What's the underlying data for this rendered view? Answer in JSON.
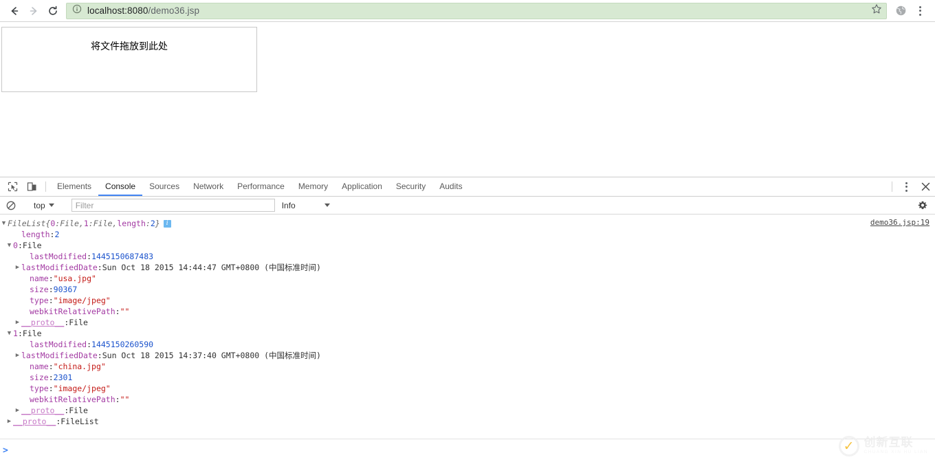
{
  "browser": {
    "back_label": "back-arrow",
    "forward_label": "forward-arrow",
    "reload_label": "reload",
    "url_host": "localhost:8080",
    "url_path": "/demo36.jsp",
    "url_full": "localhost:8080/demo36.jsp",
    "security_icon": "info-circle-icon",
    "bookmark_icon": "star-icon",
    "profile_icon": "globe-icon",
    "menu_icon": "three-dots-vertical-icon"
  },
  "page": {
    "dropzone_text": "将文件拖放到此处"
  },
  "devtools": {
    "inspect_icon": "inspect-element-icon",
    "device_icon": "device-toolbar-icon",
    "tabs": [
      {
        "label": "Elements",
        "active": false
      },
      {
        "label": "Console",
        "active": true
      },
      {
        "label": "Sources",
        "active": false
      },
      {
        "label": "Network",
        "active": false
      },
      {
        "label": "Performance",
        "active": false
      },
      {
        "label": "Memory",
        "active": false
      },
      {
        "label": "Application",
        "active": false
      },
      {
        "label": "Security",
        "active": false
      },
      {
        "label": "Audits",
        "active": false
      }
    ],
    "more_icon": "three-dots-vertical-icon",
    "close_icon": "close-icon",
    "filterbar": {
      "clear_icon": "clear-console-icon",
      "context": "top",
      "filter_placeholder": "Filter",
      "filter_value": "",
      "level": "Info",
      "settings_icon": "gear-icon"
    },
    "console": {
      "source_link": "demo36.jsp:19",
      "prompt_caret": ">",
      "rows": [
        {
          "indent": 0,
          "tri": "▼",
          "parts": [
            {
              "t": "FileList ",
              "c": "cls-italic"
            },
            {
              "t": "{",
              "c": "brace"
            },
            {
              "t": "0",
              "c": "k-prop"
            },
            {
              "t": ": ",
              "c": "brace"
            },
            {
              "t": "File",
              "c": "cls-italic"
            },
            {
              "t": ", ",
              "c": "brace"
            },
            {
              "t": "1",
              "c": "k-prop"
            },
            {
              "t": ": ",
              "c": "brace"
            },
            {
              "t": "File",
              "c": "cls-italic"
            },
            {
              "t": ", ",
              "c": "brace"
            },
            {
              "t": "length",
              "c": "k-prop"
            },
            {
              "t": ": ",
              "c": "brace"
            },
            {
              "t": "2",
              "c": "v-num"
            },
            {
              "t": "}",
              "c": "brace"
            }
          ],
          "badge": "i"
        },
        {
          "indent": 2,
          "tri": "",
          "parts": [
            {
              "t": "length",
              "c": "k-prop"
            },
            {
              "t": ": ",
              "c": "v-plain"
            },
            {
              "t": "2",
              "c": "v-num"
            }
          ]
        },
        {
          "indent": 1,
          "tri": "▼",
          "parts": [
            {
              "t": "0",
              "c": "k-prop"
            },
            {
              "t": ": ",
              "c": "v-plain"
            },
            {
              "t": "File",
              "c": "v-obj"
            }
          ]
        },
        {
          "indent": 3,
          "tri": "",
          "parts": [
            {
              "t": "lastModified",
              "c": "k-prop"
            },
            {
              "t": ": ",
              "c": "v-plain"
            },
            {
              "t": "1445150687483",
              "c": "v-num"
            }
          ]
        },
        {
          "indent": 2,
          "tri": "▶",
          "parts": [
            {
              "t": "lastModifiedDate",
              "c": "k-prop"
            },
            {
              "t": ": ",
              "c": "v-plain"
            },
            {
              "t": "Sun Oct 18 2015 14:44:47 GMT+0800 (中国标准时间)",
              "c": "v-plain"
            }
          ]
        },
        {
          "indent": 3,
          "tri": "",
          "parts": [
            {
              "t": "name",
              "c": "k-prop"
            },
            {
              "t": ": ",
              "c": "v-plain"
            },
            {
              "t": "\"usa.jpg\"",
              "c": "v-str"
            }
          ]
        },
        {
          "indent": 3,
          "tri": "",
          "parts": [
            {
              "t": "size",
              "c": "k-prop"
            },
            {
              "t": ": ",
              "c": "v-plain"
            },
            {
              "t": "90367",
              "c": "v-num"
            }
          ]
        },
        {
          "indent": 3,
          "tri": "",
          "parts": [
            {
              "t": "type",
              "c": "k-prop"
            },
            {
              "t": ": ",
              "c": "v-plain"
            },
            {
              "t": "\"image/jpeg\"",
              "c": "v-str"
            }
          ]
        },
        {
          "indent": 3,
          "tri": "",
          "parts": [
            {
              "t": "webkitRelativePath",
              "c": "k-prop"
            },
            {
              "t": ": ",
              "c": "v-plain"
            },
            {
              "t": "\"\"",
              "c": "v-str"
            }
          ]
        },
        {
          "indent": 2,
          "tri": "▶",
          "parts": [
            {
              "t": "__proto__",
              "c": "k-proto"
            },
            {
              "t": ": ",
              "c": "v-plain"
            },
            {
              "t": "File",
              "c": "v-obj"
            }
          ]
        },
        {
          "indent": 1,
          "tri": "▼",
          "parts": [
            {
              "t": "1",
              "c": "k-prop"
            },
            {
              "t": ": ",
              "c": "v-plain"
            },
            {
              "t": "File",
              "c": "v-obj"
            }
          ]
        },
        {
          "indent": 3,
          "tri": "",
          "parts": [
            {
              "t": "lastModified",
              "c": "k-prop"
            },
            {
              "t": ": ",
              "c": "v-plain"
            },
            {
              "t": "1445150260590",
              "c": "v-num"
            }
          ]
        },
        {
          "indent": 2,
          "tri": "▶",
          "parts": [
            {
              "t": "lastModifiedDate",
              "c": "k-prop"
            },
            {
              "t": ": ",
              "c": "v-plain"
            },
            {
              "t": "Sun Oct 18 2015 14:37:40 GMT+0800 (中国标准时间)",
              "c": "v-plain"
            }
          ]
        },
        {
          "indent": 3,
          "tri": "",
          "parts": [
            {
              "t": "name",
              "c": "k-prop"
            },
            {
              "t": ": ",
              "c": "v-plain"
            },
            {
              "t": "\"china.jpg\"",
              "c": "v-str"
            }
          ]
        },
        {
          "indent": 3,
          "tri": "",
          "parts": [
            {
              "t": "size",
              "c": "k-prop"
            },
            {
              "t": ": ",
              "c": "v-plain"
            },
            {
              "t": "2301",
              "c": "v-num"
            }
          ]
        },
        {
          "indent": 3,
          "tri": "",
          "parts": [
            {
              "t": "type",
              "c": "k-prop"
            },
            {
              "t": ": ",
              "c": "v-plain"
            },
            {
              "t": "\"image/jpeg\"",
              "c": "v-str"
            }
          ]
        },
        {
          "indent": 3,
          "tri": "",
          "parts": [
            {
              "t": "webkitRelativePath",
              "c": "k-prop"
            },
            {
              "t": ": ",
              "c": "v-plain"
            },
            {
              "t": "\"\"",
              "c": "v-str"
            }
          ]
        },
        {
          "indent": 2,
          "tri": "▶",
          "parts": [
            {
              "t": "__proto__",
              "c": "k-proto"
            },
            {
              "t": ": ",
              "c": "v-plain"
            },
            {
              "t": "File",
              "c": "v-obj"
            }
          ]
        },
        {
          "indent": 1,
          "tri": "▶",
          "parts": [
            {
              "t": "__proto__",
              "c": "k-proto"
            },
            {
              "t": ": ",
              "c": "v-plain"
            },
            {
              "t": "FileList",
              "c": "v-obj"
            }
          ]
        }
      ]
    }
  },
  "watermark": {
    "title": "创新互联",
    "subtitle": "CHUANG XIN HU LIAN"
  },
  "colors": {
    "omnibox_bg": "#d7e9d2",
    "tab_active": "#4285f4",
    "prop_purple": "#a33aa3",
    "number_blue": "#1a52cc",
    "string_red": "#c41a16",
    "watermark_yellow": "#f5b921"
  }
}
